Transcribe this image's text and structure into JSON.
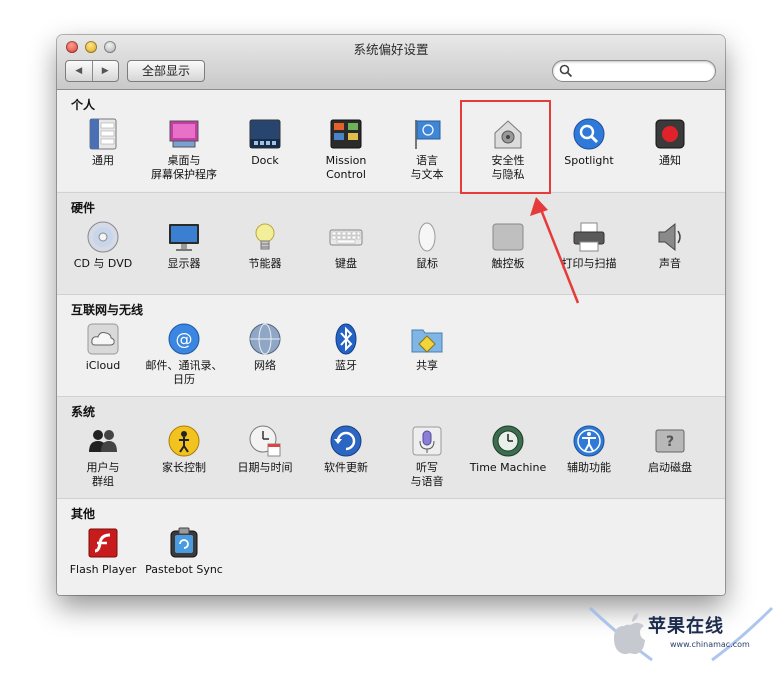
{
  "window": {
    "title": "系统偏好设置",
    "toolbar": {
      "back_label": "◀",
      "forward_label": "▶",
      "show_all_label": "全部显示",
      "search_placeholder": ""
    }
  },
  "sections": [
    {
      "title": "个人",
      "items": [
        {
          "label": "通用",
          "icon": "general-icon"
        },
        {
          "label": "桌面与\n屏幕保护程序",
          "icon": "desktop-screensaver-icon"
        },
        {
          "label": "Dock",
          "icon": "dock-icon"
        },
        {
          "label": "Mission\nControl",
          "icon": "mission-control-icon"
        },
        {
          "label": "语言\n与文本",
          "icon": "language-text-icon"
        },
        {
          "label": "安全性\n与隐私",
          "icon": "security-privacy-icon"
        },
        {
          "label": "Spotlight",
          "icon": "spotlight-icon"
        },
        {
          "label": "通知",
          "icon": "notifications-icon"
        }
      ]
    },
    {
      "title": "硬件",
      "items": [
        {
          "label": "CD 与 DVD",
          "icon": "cd-dvd-icon"
        },
        {
          "label": "显示器",
          "icon": "displays-icon"
        },
        {
          "label": "节能器",
          "icon": "energy-saver-icon"
        },
        {
          "label": "键盘",
          "icon": "keyboard-icon"
        },
        {
          "label": "鼠标",
          "icon": "mouse-icon"
        },
        {
          "label": "触控板",
          "icon": "trackpad-icon"
        },
        {
          "label": "打印与扫描",
          "icon": "print-scan-icon"
        },
        {
          "label": "声音",
          "icon": "sound-icon"
        }
      ]
    },
    {
      "title": "互联网与无线",
      "items": [
        {
          "label": "iCloud",
          "icon": "icloud-icon"
        },
        {
          "label": "邮件、通讯录、\n日历",
          "icon": "mail-contacts-calendars-icon"
        },
        {
          "label": "网络",
          "icon": "network-icon"
        },
        {
          "label": "蓝牙",
          "icon": "bluetooth-icon"
        },
        {
          "label": "共享",
          "icon": "sharing-icon"
        }
      ]
    },
    {
      "title": "系统",
      "items": [
        {
          "label": "用户与\n群组",
          "icon": "users-groups-icon"
        },
        {
          "label": "家长控制",
          "icon": "parental-controls-icon"
        },
        {
          "label": "日期与时间",
          "icon": "date-time-icon"
        },
        {
          "label": "软件更新",
          "icon": "software-update-icon"
        },
        {
          "label": "听写\n与语音",
          "icon": "dictation-speech-icon"
        },
        {
          "label": "Time Machine",
          "icon": "time-machine-icon"
        },
        {
          "label": "辅助功能",
          "icon": "accessibility-icon"
        },
        {
          "label": "启动磁盘",
          "icon": "startup-disk-icon"
        }
      ]
    },
    {
      "title": "其他",
      "items": [
        {
          "label": "Flash Player",
          "icon": "flash-player-icon"
        },
        {
          "label": "Pastebot Sync",
          "icon": "pastebot-sync-icon"
        }
      ]
    }
  ],
  "annotation": {
    "highlight_color": "#e53b3b",
    "highlighted_item": "安全性\n与隐私"
  },
  "watermark": {
    "title": "苹果在线",
    "url": "www.chinamac.com"
  }
}
